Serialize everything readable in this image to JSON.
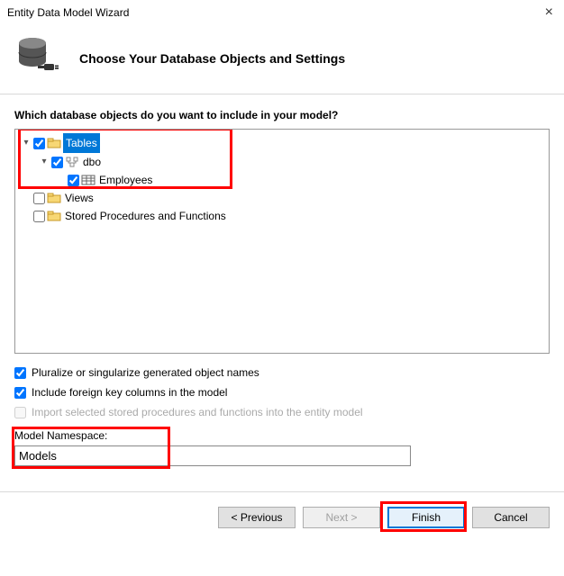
{
  "window": {
    "title": "Entity Data Model Wizard"
  },
  "header": {
    "title": "Choose Your Database Objects and Settings"
  },
  "prompt": "Which database objects do you want to include in your model?",
  "tree": {
    "tables": {
      "label": "Tables",
      "checked": true,
      "expanded": true
    },
    "dbo": {
      "label": "dbo",
      "checked": true,
      "expanded": true
    },
    "employees": {
      "label": "Employees",
      "checked": true
    },
    "views": {
      "label": "Views",
      "checked": false
    },
    "sprocs": {
      "label": "Stored Procedures and Functions",
      "checked": false
    }
  },
  "options": {
    "pluralize": {
      "label": "Pluralize or singularize generated object names",
      "checked": true
    },
    "fk": {
      "label": "Include foreign key columns in the model",
      "checked": true
    },
    "importSprocs": {
      "label": "Import selected stored procedures and functions into the entity model",
      "checked": false
    }
  },
  "namespace": {
    "label": "Model Namespace:",
    "value": "Models"
  },
  "buttons": {
    "previous": "< Previous",
    "next": "Next >",
    "finish": "Finish",
    "cancel": "Cancel"
  }
}
